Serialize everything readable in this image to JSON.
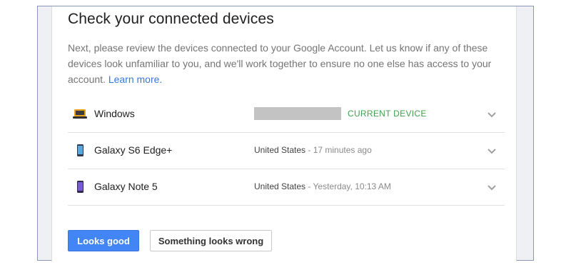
{
  "header": {
    "title": "Check your connected devices"
  },
  "description": {
    "text": "Next, please review the devices connected to your Google Account. Let us know if any of these devices look unfamiliar to you, and we'll work together to ensure no one else has access to your account. ",
    "learn_more": "Learn more."
  },
  "devices": [
    {
      "name": "Windows",
      "icon": "laptop-icon",
      "current_label": "CURRENT DEVICE"
    },
    {
      "name": "Galaxy S6 Edge+",
      "icon": "phone-icon",
      "location": "United States",
      "last_seen": " - 17 minutes ago"
    },
    {
      "name": "Galaxy Note 5",
      "icon": "phone-icon",
      "location": "United States",
      "last_seen": " - Yesterday, 10:13 AM"
    }
  ],
  "actions": {
    "primary_label": "Looks good",
    "secondary_label": "Something looks wrong"
  },
  "colors": {
    "primary_button": "#4285f4",
    "link": "#3a78d8",
    "current_device": "#3ea14a",
    "laptop_icon": "#e6a21b",
    "phone_icon": "#6a5acd"
  }
}
